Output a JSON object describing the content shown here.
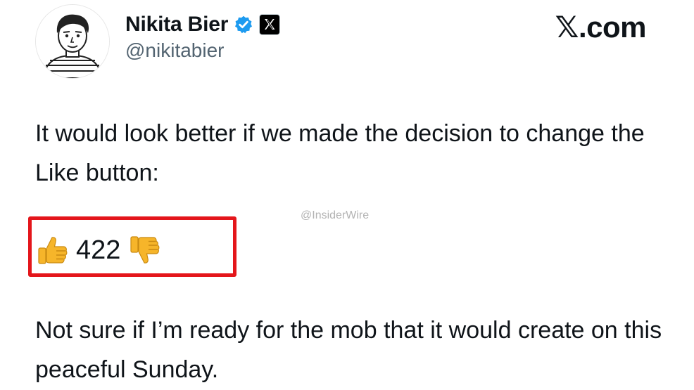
{
  "author": {
    "display_name": "Nikita Bier",
    "handle": "@nikitabier",
    "verified_icon": "verified-badge-icon",
    "affiliation_icon": "x-logo-badge-icon",
    "avatar": "sketched-portrait-avatar"
  },
  "site_label": "𝕏.com",
  "tweet": {
    "paragraph_1": "It would look better if we made the decision to change the Like button:",
    "paragraph_2": "Not sure if I’m ready for the mob that it would create on this peaceful Sunday."
  },
  "reactions": {
    "like_icon": "thumbs-up-icon",
    "count": "422",
    "dislike_icon": "thumbs-down-icon"
  },
  "watermark": "@InsiderWire",
  "colors": {
    "text": "#0f1419",
    "secondary_text": "#536471",
    "verified_blue": "#1d9bf0",
    "highlight_red": "#e4161b",
    "emoji_yellow": "#f6b52a"
  }
}
